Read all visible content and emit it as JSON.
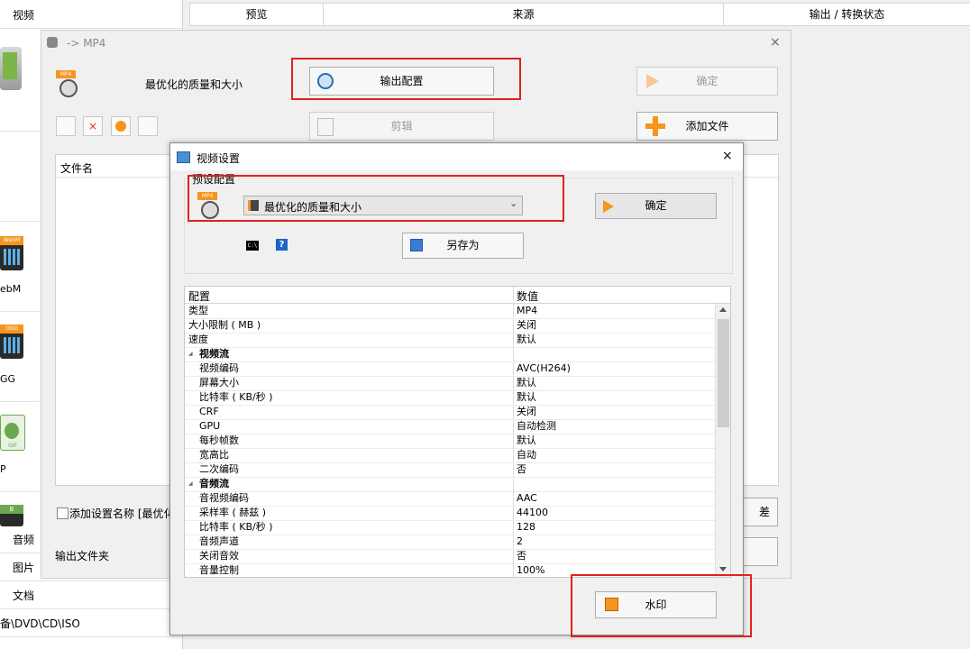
{
  "sidebar": {
    "top_category": "视频",
    "formats": [
      {
        "label": "ebM",
        "badge": "WebM"
      },
      {
        "label": "GG",
        "badge": "OGG"
      },
      {
        "label": "P",
        "badge": "GIF"
      }
    ],
    "badge_partial": "B",
    "categories": [
      "音频",
      "图片",
      "文档",
      "备\\DVD\\CD\\ISO"
    ]
  },
  "header": {
    "col_preview": "预览",
    "col_source": "来源",
    "col_status": "输出 / 转换状态"
  },
  "dialog1": {
    "title": "-> MP4",
    "close": "×",
    "preset_name": "最优化的质量和大小",
    "output_config_button": "输出配置",
    "confirm_button": "确定",
    "clip_button": "剪辑",
    "add_file_button": "添加文件",
    "filename_header": "文件名",
    "add_setting_name_label": "添加设置名称 [最优化",
    "output_folder_label": "输出文件夹",
    "partial_button_text": "差",
    "format_badge": "MP4"
  },
  "dialog2": {
    "title": "视频设置",
    "close": "×",
    "preset_group_label": "预设配置",
    "format_badge": "MP4",
    "preset_select": "最优化的质量和大小",
    "confirm_button": "确定",
    "save_as_button": "另存为",
    "help_icon": "?",
    "cmd_icon": "C:\\",
    "watermark_button": "水印",
    "table": {
      "col_config": "配置",
      "col_value": "数值",
      "rows": [
        {
          "k": "类型",
          "v": "MP4"
        },
        {
          "k": "大小限制 ( MB )",
          "v": "关闭"
        },
        {
          "k": "速度",
          "v": "默认"
        },
        {
          "section": "视频流"
        },
        {
          "k": "视频编码",
          "v": "AVC(H264)",
          "indent": true
        },
        {
          "k": "屏幕大小",
          "v": "默认",
          "indent": true
        },
        {
          "k": "比特率 ( KB/秒 )",
          "v": "默认",
          "indent": true
        },
        {
          "k": "CRF",
          "v": "关闭",
          "indent": true
        },
        {
          "k": "GPU",
          "v": "自动检测",
          "indent": true
        },
        {
          "k": "每秒帧数",
          "v": "默认",
          "indent": true
        },
        {
          "k": "宽高比",
          "v": "自动",
          "indent": true
        },
        {
          "k": "二次编码",
          "v": "否",
          "indent": true
        },
        {
          "section": "音频流"
        },
        {
          "k": "音视频编码",
          "v": "AAC",
          "indent": true
        },
        {
          "k": "采样率 ( 赫兹 )",
          "v": "44100",
          "indent": true
        },
        {
          "k": "比特率 ( KB/秒 )",
          "v": "128",
          "indent": true
        },
        {
          "k": "音频声道",
          "v": "2",
          "indent": true
        },
        {
          "k": "关闭音效",
          "v": "否",
          "indent": true
        },
        {
          "k": "音量控制",
          "v": "100%",
          "indent": true
        }
      ]
    }
  },
  "colors": {
    "highlight": "#e02020",
    "accent": "#f7941d"
  }
}
